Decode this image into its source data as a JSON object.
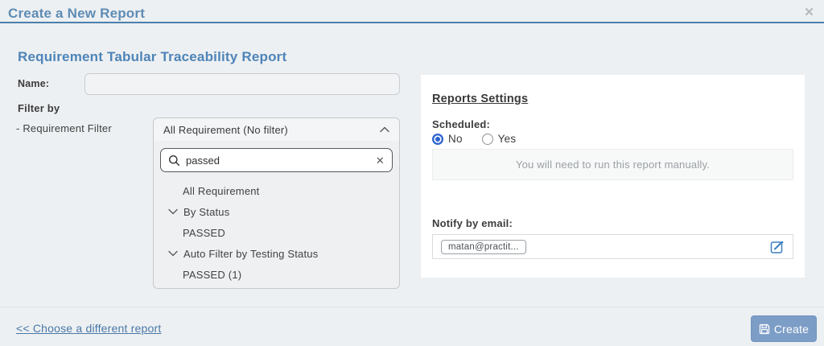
{
  "header": {
    "title": "Create a New Report"
  },
  "icons": {
    "close": "✕",
    "clear": "✕"
  },
  "report": {
    "title": "Requirement Tabular Traceability Report",
    "name_label": "Name:",
    "name_value": "",
    "filter_by_label": "Filter by",
    "requirement_filter_label": "- Requirement Filter",
    "filter_select": {
      "selected": "All Requirement (No filter)",
      "search_value": "passed",
      "options": [
        {
          "label": "All Requirement",
          "type": "item"
        },
        {
          "label": "By Status",
          "type": "group"
        },
        {
          "label": "PASSED",
          "type": "item"
        },
        {
          "label": "Auto Filter by Testing Status",
          "type": "group"
        },
        {
          "label": "PASSED (1)",
          "type": "item"
        }
      ]
    }
  },
  "settings": {
    "heading": "Reports Settings",
    "scheduled_label": "Scheduled:",
    "options": [
      "No",
      "Yes"
    ],
    "selected_option": "No",
    "manual_note": "You will need to run this report manually.",
    "notify_label": "Notify by email:",
    "email_chip": "matan@practit..."
  },
  "footer": {
    "back_link": "<< Choose a different report",
    "create_label": "Create"
  },
  "colors": {
    "background": "#edf0f2",
    "header_blue": "#5e8cb5",
    "header_line": "#4d80ad",
    "section_title_blue": "#4e84b8",
    "link_blue": "#4a78a8",
    "create_button": "#7c9dc6",
    "radio_selected": "#2e64d0",
    "edit_icon_blue": "#3e7fc1",
    "panel_white": "#ffffff"
  }
}
